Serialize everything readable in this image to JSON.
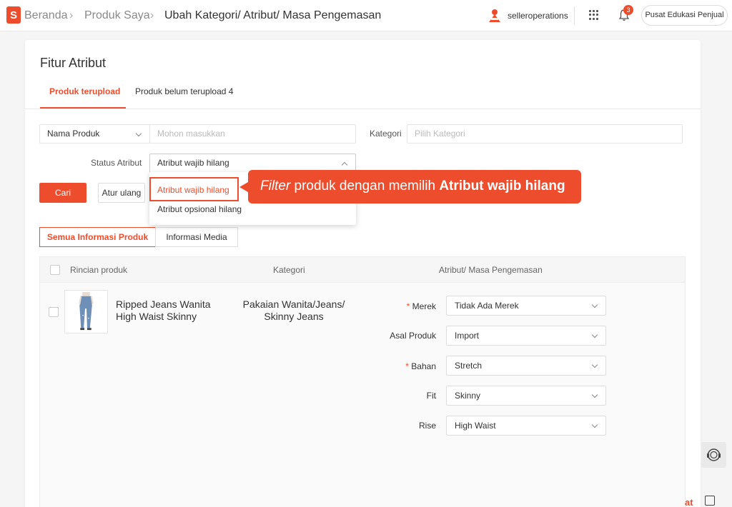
{
  "breadcrumb": {
    "home": "Beranda",
    "products": "Produk Saya",
    "current": "Ubah Kategori/ Atribut/ Masa Pengemasan"
  },
  "logo_text": "S",
  "header": {
    "username": "selleroperations",
    "notification_count": "3",
    "edu_button": "Pusat Edukasi Penjual"
  },
  "page": {
    "title": "Fitur Atribut",
    "tabs": [
      {
        "label": "Produk terupload",
        "active": true
      },
      {
        "label": "Produk belum terupload 4",
        "active": false
      }
    ]
  },
  "filters": {
    "search_type": "Nama Produk",
    "search_placeholder": "Mohon masukkan",
    "category_label": "Kategori",
    "category_placeholder": "Pilih Kategori",
    "status_label": "Status Atribut",
    "status_value": "Atribut wajib hilang",
    "status_options": [
      "Atribut wajib hilang",
      "Atribut opsional hilang"
    ],
    "search_button": "Cari",
    "reset_button": "Atur ulang"
  },
  "callout": {
    "italic": "Filter",
    "normal": " produk dengan memilih ",
    "bold": "Atribut wajib hilang"
  },
  "view_tabs": [
    "Semua Informasi Produk",
    "Informasi Media"
  ],
  "table": {
    "headers": [
      "Rincian produk",
      "Kategori",
      "Atribut/ Masa Pengemasan"
    ],
    "row": {
      "product_name": "Ripped Jeans Wanita High Waist Skinny",
      "category": "Pakaian Wanita/Jeans/ Skinny Jeans",
      "attributes": [
        {
          "label": "Merek",
          "required": true,
          "value": "Tidak Ada Merek"
        },
        {
          "label": "Asal Produk",
          "required": false,
          "value": "Import"
        },
        {
          "label": "Bahan",
          "required": true,
          "value": "Stretch"
        },
        {
          "label": "Fit",
          "required": false,
          "value": "Skinny"
        },
        {
          "label": "Rise",
          "required": false,
          "value": "High Waist"
        }
      ]
    }
  },
  "chat_label": "at",
  "colors": {
    "accent": "#ee4d2d"
  }
}
